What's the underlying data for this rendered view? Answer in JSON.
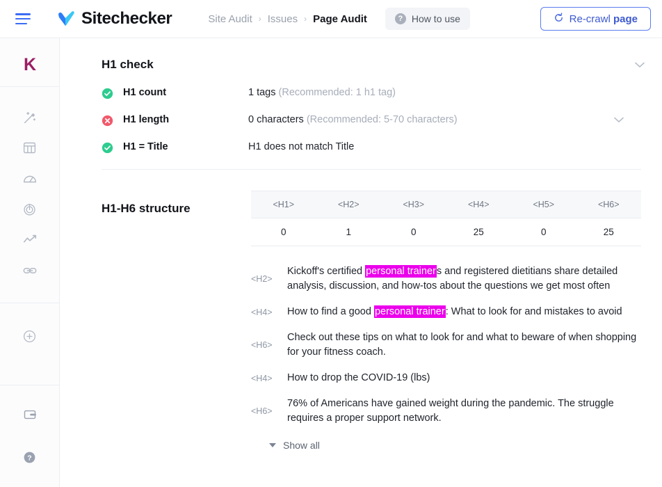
{
  "topbar": {
    "menu_icon": "hamburger-icon",
    "brand": "Sitechecker",
    "brand_icon": "check-logo-icon",
    "breadcrumb": [
      {
        "label": "Site Audit",
        "current": false
      },
      {
        "label": "Issues",
        "current": false
      },
      {
        "label": "Page Audit",
        "current": true
      }
    ],
    "breadcrumb_sep": "›",
    "howto_label": "How to use",
    "howto_icon": "question-mark-icon",
    "recrawl_label_1": "Re-crawl ",
    "recrawl_label_2": "page",
    "recrawl_icon": "refresh-icon"
  },
  "rail": {
    "logo": "K",
    "logo_color": "#9b1f63",
    "items": [
      {
        "name": "magic-wand-icon"
      },
      {
        "name": "columns-icon"
      },
      {
        "name": "speedometer-icon"
      },
      {
        "name": "radar-icon"
      },
      {
        "name": "trend-line-icon"
      },
      {
        "name": "link-icon"
      }
    ],
    "add_icon": "plus-circle-icon",
    "bottom": [
      {
        "name": "wallet-icon"
      },
      {
        "name": "help-circle-icon"
      }
    ]
  },
  "h1_check": {
    "title": "H1 check",
    "collapse_icon": "chevron-down-icon",
    "rows": [
      {
        "status": "pass",
        "label": "H1 count",
        "value": "1 tags ",
        "value_muted": "(Recommended: 1 h1 tag)",
        "has_chevron": false
      },
      {
        "status": "fail",
        "label": "H1 length",
        "value": "0 characters ",
        "value_muted": "(Recommended: 5-70 characters)",
        "has_chevron": true
      },
      {
        "status": "pass",
        "label": "H1 = Title",
        "value": "H1 does not match Title",
        "value_muted": "",
        "has_chevron": false
      }
    ],
    "colors": {
      "pass": "#2ecc8f",
      "fail": "#f2596b"
    }
  },
  "structure": {
    "title": "H1-H6 structure",
    "table": {
      "headers": [
        "<H1>",
        "<H2>",
        "<H3>",
        "<H4>",
        "<H5>",
        "<H6>"
      ],
      "values": [
        "0",
        "1",
        "0",
        "25",
        "0",
        "25"
      ]
    },
    "headings": [
      {
        "tag": "<H2>",
        "pre": "Kickoff's certified ",
        "highlight": "personal trainer",
        "post": "s and registered dietitians share detailed analysis, discussion, and how-tos about the questions we get most often"
      },
      {
        "tag": "<H4>",
        "pre": "How to find a good ",
        "highlight": "personal trainer",
        "post": ": What to look for and mistakes to avoid"
      },
      {
        "tag": "<H6>",
        "pre": "Check out these tips on what to look for and what to beware of when shopping for your fitness coach.",
        "highlight": "",
        "post": ""
      },
      {
        "tag": "<H4>",
        "pre": "How to drop the COVID-19 (lbs)",
        "highlight": "",
        "post": ""
      },
      {
        "tag": "<H6>",
        "pre": "76% of Americans have gained weight during the pandemic. The struggle requires a proper support network.",
        "highlight": "",
        "post": ""
      }
    ],
    "show_all_label": "Show all",
    "show_all_icon": "caret-down-icon",
    "highlight_color": "#ec00ec"
  }
}
